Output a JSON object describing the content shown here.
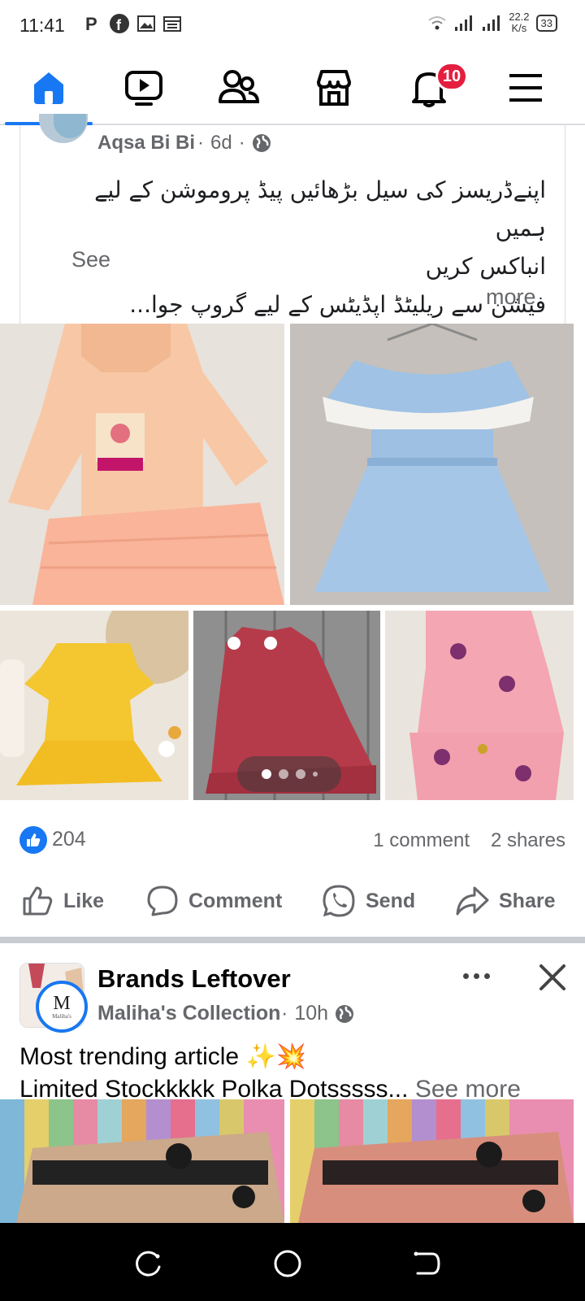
{
  "status_bar": {
    "time": "11:41",
    "network_speed_value": "22.2",
    "network_speed_unit": "K/s",
    "battery": "33",
    "left_icons": [
      "parking-icon",
      "facebook-icon",
      "gallery-icon",
      "calendar-icon"
    ],
    "right_icons": [
      "wifi-icon",
      "signal-icon",
      "signal-icon",
      "battery-icon"
    ]
  },
  "nav": {
    "items": [
      {
        "name": "home",
        "icon": "home-icon",
        "active": true
      },
      {
        "name": "watch",
        "icon": "video-icon"
      },
      {
        "name": "friends",
        "icon": "friends-icon"
      },
      {
        "name": "marketplace",
        "icon": "store-icon"
      },
      {
        "name": "notifications",
        "icon": "bell-icon",
        "badge": "10"
      },
      {
        "name": "menu",
        "icon": "menu-icon"
      }
    ],
    "accent": "#1877f2",
    "badge_color": "#e41e3f"
  },
  "post1": {
    "author": "Aqsa Bi Bi",
    "time": "6d",
    "separator": "·",
    "privacy_icon": "globe-icon",
    "text_line1": "اپنےڈریسز کی سیل بڑھائیں پیڈ پروموشن کے لیے ہمیں",
    "text_line2": "انباکس کریں",
    "text_line3": "فیشن سے ریلیٹڈ اپڈیٹس کے لیے گروپ جوا...",
    "see_more_a": "See",
    "see_more_b": "more",
    "photos": [
      "peach-kurta-sharara",
      "blue-lace-dress",
      "yellow-ruffle-dress",
      "red-gingham-dress",
      "pink-floral-set"
    ],
    "carousel_dots": 4,
    "reactions": "204",
    "comments": "1 comment",
    "shares": "2 shares",
    "actions": {
      "like": "Like",
      "comment": "Comment",
      "send": "Send",
      "share": "Share"
    }
  },
  "post2": {
    "group": "Brands Leftover",
    "page": "Maliha's Collection",
    "separator": "·",
    "time": "10h",
    "avatar_letter": "M",
    "avatar_subtitle": "Maliha's",
    "line1": "Most trending article ✨💥",
    "line2": "Limited Stockkkkk Polka Dotsssss...",
    "see_more": "See more"
  },
  "system_nav": [
    "recents-icon",
    "home-circle-icon",
    "back-icon"
  ]
}
